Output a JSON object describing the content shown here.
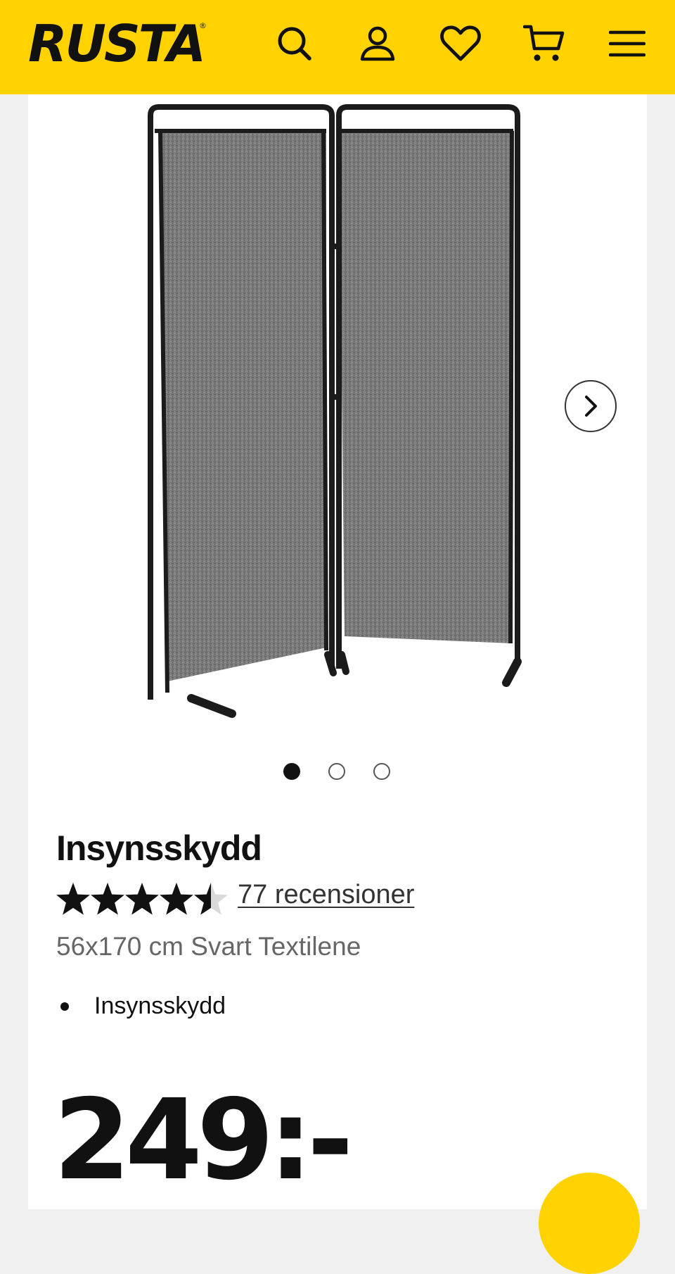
{
  "header": {
    "logo": "RUSTA",
    "logo_mark": "®",
    "icons": [
      "search-icon",
      "account-icon",
      "wishlist-heart-icon",
      "cart-icon",
      "menu-icon"
    ],
    "brand_color": "#ffd200"
  },
  "gallery": {
    "image_alt": "Insynsskydd",
    "slide_count": 3,
    "active_slide": 1,
    "next_icon": "chevron-right-icon"
  },
  "product": {
    "title": "Insynsskydd",
    "rating": 4.5,
    "rating_max": 5,
    "reviews_text": "77 recensioner",
    "subtitle": "56x170 cm Svart Textilene",
    "features": [
      "Insynsskydd"
    ],
    "price": "249:-"
  }
}
